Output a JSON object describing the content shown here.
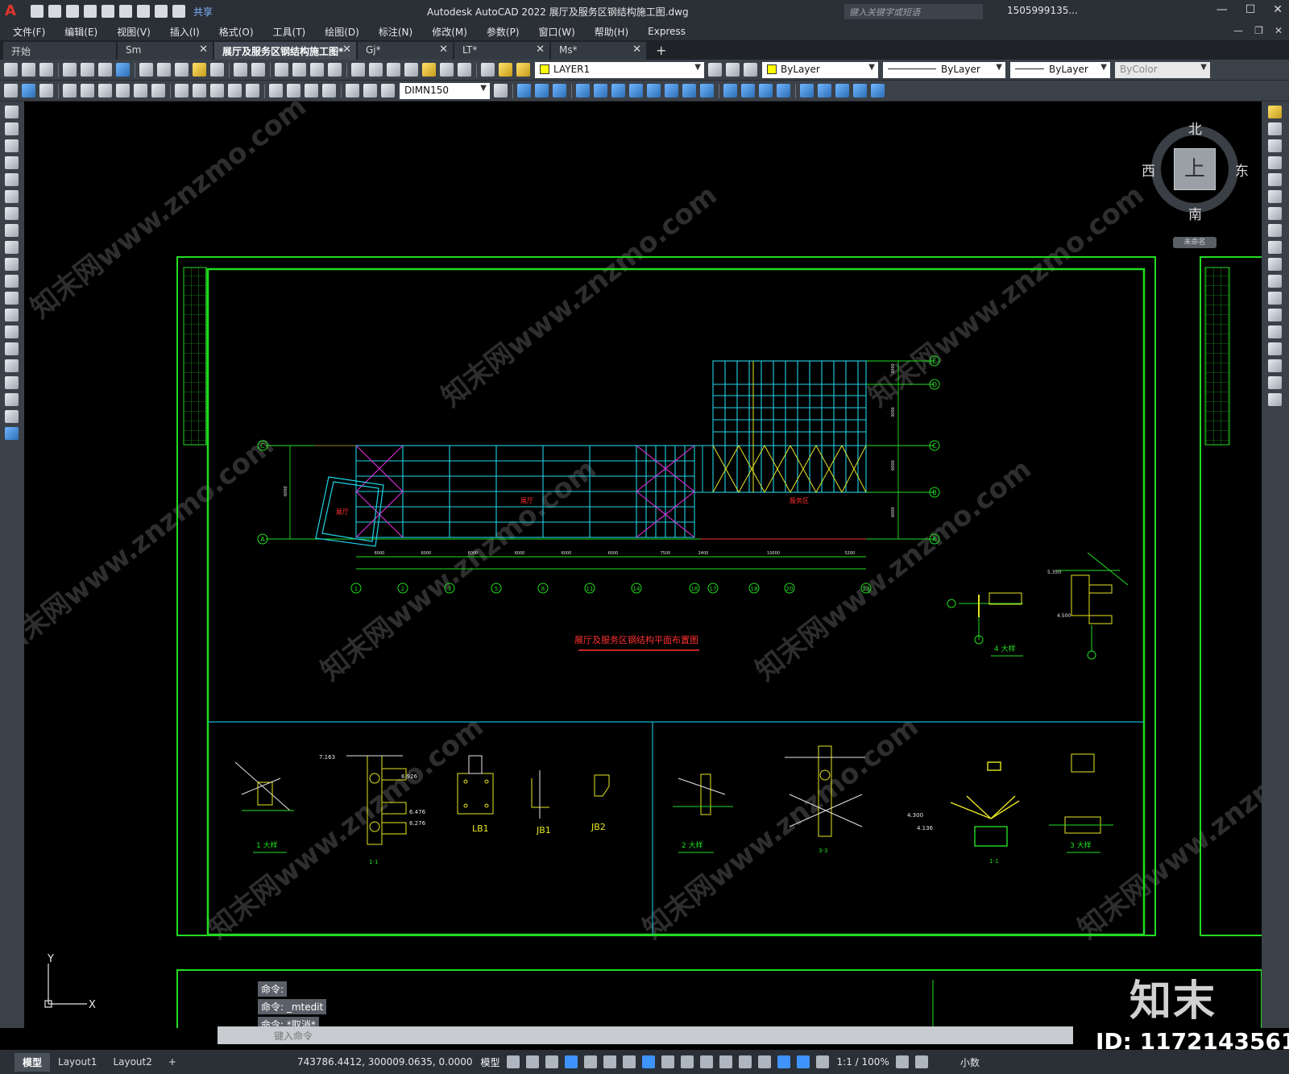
{
  "titlebar": {
    "logo": "A",
    "share": "共享",
    "title": "Autodesk AutoCAD 2022    展厅及服务区钢结构施工图.dwg",
    "search_placeholder": "键入关键字或短语",
    "user": "1505999135...",
    "controls": [
      "—",
      "☐",
      "✕"
    ]
  },
  "menubar": {
    "items": [
      "文件(F)",
      "编辑(E)",
      "视图(V)",
      "插入(I)",
      "格式(O)",
      "工具(T)",
      "绘图(D)",
      "标注(N)",
      "修改(M)",
      "参数(P)",
      "窗口(W)",
      "帮助(H)",
      "Express"
    ]
  },
  "tabs": {
    "items": [
      {
        "label": "开始",
        "close": ""
      },
      {
        "label": "Sm",
        "close": "✕"
      },
      {
        "label": "展厅及服务区钢结构施工图*",
        "close": "✕"
      },
      {
        "label": "Gj*",
        "close": "✕"
      },
      {
        "label": "LT*",
        "close": "✕"
      },
      {
        "label": "Ms*",
        "close": "✕"
      }
    ],
    "add": "+"
  },
  "toolbar": {
    "layer": "LAYER1",
    "color": "ByLayer",
    "linetype": "ByLayer",
    "lineweight": "ByLayer",
    "plotstyle": "ByColor",
    "dimstyle": "DIMN150",
    "colors": {
      "layer_swatch": "#ffff00",
      "color_swatch": "#ffff00"
    }
  },
  "viewcube": {
    "north": "北",
    "south": "南",
    "west": "西",
    "east": "东",
    "face": "上",
    "wcs": "未命名"
  },
  "drawing": {
    "plan_title": "展厅及服务区钢结构平面布置图",
    "room_labels": [
      "展厅",
      "服务区",
      "展厅及服务区"
    ],
    "axis_letters": [
      "E",
      "D",
      "C",
      "B",
      "A"
    ],
    "axis_numbers": [
      "1",
      "2",
      "3",
      "5",
      "8",
      "11",
      "14",
      "16",
      "17",
      "18",
      "20",
      "23"
    ],
    "spans": [
      "6000",
      "6000",
      "6000",
      "6000",
      "6000",
      "6000",
      "7500",
      "2400",
      "10000",
      "5200"
    ],
    "vertical_dims": [
      "3000",
      "3000",
      "6000",
      "6000"
    ],
    "details": [
      "1  大样",
      "2  大样",
      "3  大样",
      "4  大样"
    ],
    "part_labels": [
      "LB1",
      "JB1",
      "JB2",
      "1-1",
      "1-1",
      "3-3"
    ],
    "elevations": [
      "7.163",
      "6.926",
      "6.476",
      "6.276",
      "4.300",
      "4.136",
      "5.350",
      "4.500"
    ]
  },
  "command": {
    "history": [
      "命令:",
      "命令: _mtedit",
      "命令: *取消*"
    ],
    "placeholder": "键入命令"
  },
  "statusbar": {
    "layouts": [
      "模型",
      "Layout1",
      "Layout2"
    ],
    "add": "+",
    "coords": "743786.4412, 300009.0635, 0.0000",
    "space": "模型",
    "scale": "1:1 / 100%",
    "units": "小数"
  },
  "watermark": {
    "logo": "知末",
    "id": "ID: 1172143561",
    "text": "知末网www.znzmo.com"
  }
}
